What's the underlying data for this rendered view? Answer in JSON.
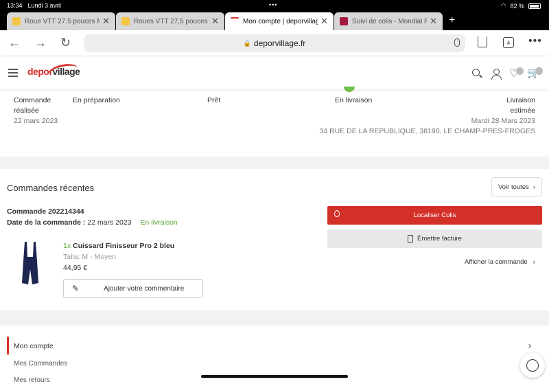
{
  "status": {
    "time": "13:34",
    "date": "Lundi 3 avril",
    "battery": "82 %"
  },
  "tabs": [
    {
      "title": "Roue VTT 27.5 pouces M",
      "fav_color": "#f4c542"
    },
    {
      "title": "Roues VTT 27,5 pouces c",
      "fav_color": "#f4c542"
    },
    {
      "title": "Mon compte | deporvillag",
      "fav_color": "#d4302a"
    },
    {
      "title": "Suivi de colis - Mondial R",
      "fav_color": "#a3183f"
    }
  ],
  "toolbar": {
    "url": "deporvillage.fr",
    "tab_count": "4"
  },
  "header": {
    "logo_depor": "depor",
    "logo_village": "village"
  },
  "tracker": {
    "step1_l1": "Commande",
    "step1_l2": "réalisée",
    "step1_date": "22 mars 2023",
    "step2": "En préparation",
    "step3": "Prêt",
    "step4": "En livraison",
    "step5_l1": "Livraison",
    "step5_l2": "estimée",
    "step5_date": "Mardi 28 Mars 2023",
    "address": "34 RUE DE LA REPUBLIQUE, 38190, LE CHAMP-PRES-FROGES"
  },
  "recent": {
    "title": "Commandes récentes",
    "see_all": "Voir toutes",
    "order_number": "Commande 202214344",
    "order_date_label": "Date de la commande :",
    "order_date": "22 mars 2023",
    "order_status": "En livraison",
    "product_qty": "1x",
    "product_name": "Cuissard Finisseur Pro 2 bleu",
    "product_size": "Talla: M - Moyen",
    "product_price": "44,95 €",
    "comment_btn": "Ajouter votre commentaire",
    "locate_btn": "Localiser Colis",
    "invoice_btn": "Émettre facture",
    "show_order": "Afficher la commande"
  },
  "menu": {
    "item1": "Mon compte",
    "item2": "Mes Commandes",
    "item3": "Mes retours"
  },
  "colors": {
    "brand_red": "#d4302a",
    "status_green": "#5aa536"
  }
}
